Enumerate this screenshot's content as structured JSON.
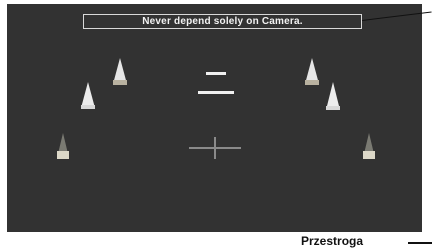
{
  "screen": {
    "warning_text": "Never depend solely on Camera."
  },
  "caption": {
    "label": "Przestroga"
  },
  "colors": {
    "screen_background": "#323232",
    "banner_text": "#f2f2f2",
    "marker_cone": "#e6e6e6",
    "guide_line": "#f0f0f0",
    "crosshair": "#8a8a8a"
  }
}
